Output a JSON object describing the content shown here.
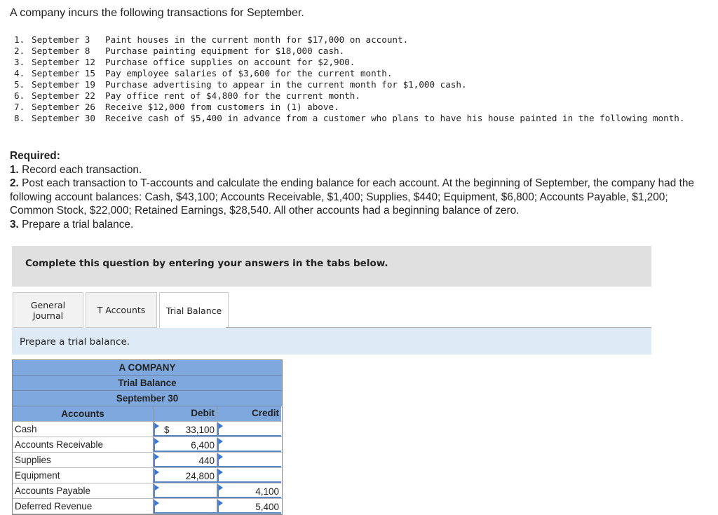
{
  "intro": "A company incurs the following transactions for September.",
  "transactions": [
    {
      "n": "1.",
      "date": "September 3",
      "text": "Paint houses in the current month for $17,000 on account."
    },
    {
      "n": "2.",
      "date": "September 8",
      "text": "Purchase painting equipment for $18,000 cash."
    },
    {
      "n": "3.",
      "date": "September 12",
      "text": "Purchase office supplies on account for $2,900."
    },
    {
      "n": "4.",
      "date": "September 15",
      "text": "Pay employee salaries of $3,600 for the current month."
    },
    {
      "n": "5.",
      "date": "September 19",
      "text": "Purchase advertising to appear in the current month for $1,000 cash."
    },
    {
      "n": "6.",
      "date": "September 22",
      "text": "Pay office rent of $4,800 for the current month."
    },
    {
      "n": "7.",
      "date": "September 26",
      "text": "Receive $12,000 from customers in (1) above."
    },
    {
      "n": "8.",
      "date": "September 30",
      "text": "Receive cash of $5,400 in advance from a customer who plans to have his house painted in the following month."
    }
  ],
  "required": {
    "heading": "Required:",
    "items": [
      {
        "n": "1.",
        "text": " Record each transaction."
      },
      {
        "n": "2.",
        "text": " Post each transaction to T-accounts and calculate the ending balance for each account. At the beginning of September, the company had the following account balances: Cash, $43,100; Accounts Receivable, $1,400; Supplies, $440; Equipment, $6,800; Accounts Payable, $1,200; Common Stock, $22,000; Retained Earnings, $28,540. All other accounts had a beginning balance of zero."
      },
      {
        "n": "3.",
        "text": " Prepare a trial balance."
      }
    ]
  },
  "banner": "Complete this question by entering your answers in the tabs below.",
  "tabs": [
    {
      "label": "General Journal"
    },
    {
      "label": "T Accounts"
    },
    {
      "label": "Trial Balance",
      "active": true
    }
  ],
  "prompt": "Prepare a trial balance.",
  "trial_balance": {
    "company": "A COMPANY",
    "title": "Trial Balance",
    "date": "September 30",
    "headers": {
      "accounts": "Accounts",
      "debit": "Debit",
      "credit": "Credit"
    },
    "currency": "$",
    "rows": [
      {
        "account": "Cash",
        "debit": "33,100",
        "credit": ""
      },
      {
        "account": "Accounts Receivable",
        "debit": "6,400",
        "credit": ""
      },
      {
        "account": "Supplies",
        "debit": "440",
        "credit": ""
      },
      {
        "account": "Equipment",
        "debit": "24,800",
        "credit": ""
      },
      {
        "account": "Accounts Payable",
        "debit": "",
        "credit": "4,100"
      },
      {
        "account": "Deferred Revenue",
        "debit": "",
        "credit": "5,400"
      }
    ]
  },
  "colors": {
    "table_header": "#7fa9de",
    "prompt_bg": "#deebf7",
    "banner_bg": "#e0e0e0",
    "input_marker": "#3a78d6"
  }
}
